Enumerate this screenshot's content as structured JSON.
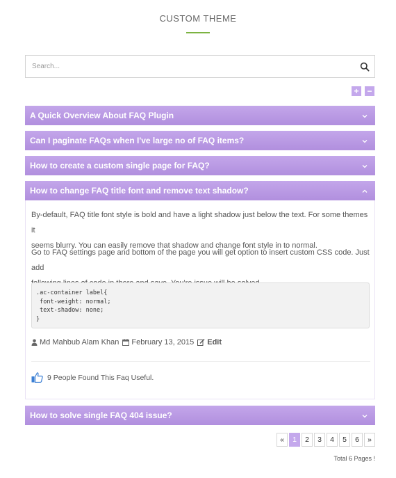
{
  "header": {
    "title": "CUSTOM THEME"
  },
  "search": {
    "placeholder": "Search..."
  },
  "expand": {
    "expand_label": "+",
    "collapse_label": "−"
  },
  "faqs": [
    {
      "title": "A Quick Overview About FAQ Plugin"
    },
    {
      "title": "Can I paginate FAQs when I've large no of FAQ items?"
    },
    {
      "title": "How to create a custom single page for FAQ?"
    },
    {
      "title": "How to change FAQ title font and remove text shadow?"
    },
    {
      "title": "How to solve single FAQ 404 issue?"
    }
  ],
  "answer": {
    "p1_line1": "By-default, FAQ title font style is bold and have a light shadow just below the text. For some themes it",
    "p1_line2": "seems blurry. You can easily remove that shadow and change font style in to normal.",
    "p2_line1": "Go to FAQ settings page and bottom of the page you will get option to insert custom CSS code. Just add",
    "p2_line2": "following lines of code in there and save. You're issue will be solved.",
    "code": ".ac-container label{\n font-weight: normal;\n text-shadow: none;\n}",
    "author": "Md Mahbub Alam Khan",
    "date": "February 13, 2015",
    "edit": "Edit",
    "useful_text": "9 People Found This Faq Useful."
  },
  "pagination": {
    "prev": "«",
    "pages": [
      "1",
      "2",
      "3",
      "4",
      "5",
      "6"
    ],
    "next": "»",
    "active": "1",
    "total": "Total 6 Pages !"
  },
  "colors": {
    "accent": "#c4a8ec",
    "underline": "#7cb342"
  }
}
